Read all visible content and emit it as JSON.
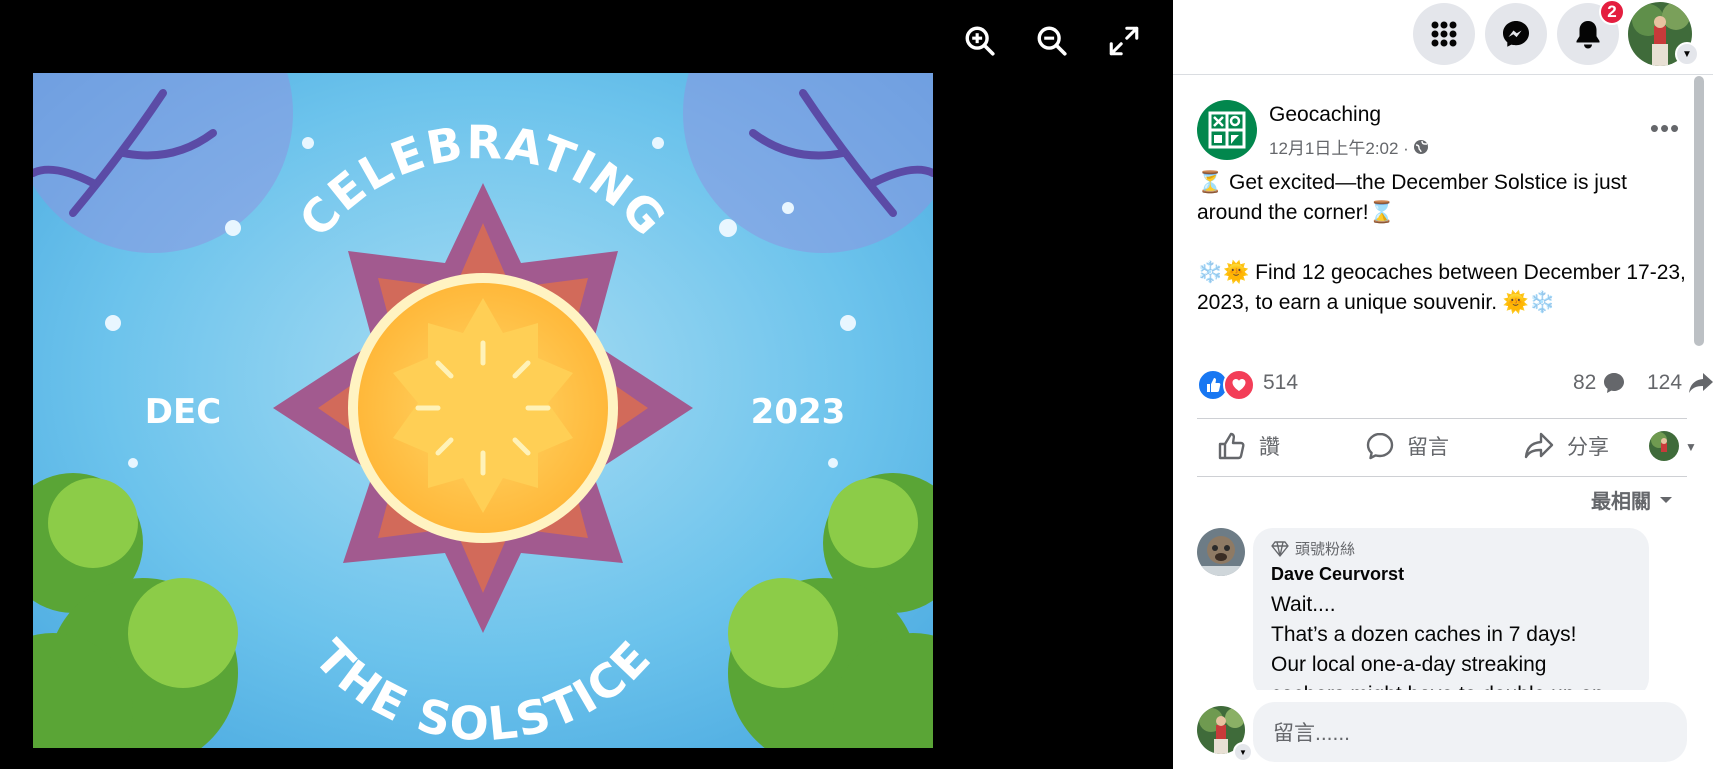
{
  "viewer": {
    "tools": [
      "zoom-in",
      "zoom-out",
      "fullscreen"
    ],
    "image": {
      "top_text": "CELEBRATING",
      "bottom_text": "THE SOLSTICE",
      "left_text": "DEC",
      "right_text": "2023"
    }
  },
  "topbar": {
    "menu_icon": "grid-menu-icon",
    "messenger_icon": "messenger-icon",
    "notifications_icon": "bell-icon",
    "notification_count": "2"
  },
  "post": {
    "page_name": "Geocaching",
    "time": "12月1日上午2:02 ·",
    "paragraph1": "⏳ Get excited—the December Solstice is just around the corner!⌛",
    "paragraph2": "❄️🌞 Find 12 geocaches between December 17-23, 2023, to earn a unique souvenir. 🌞❄️",
    "reactions_count": "514",
    "comments_count": "82",
    "shares_count": "124",
    "like_label": "讚",
    "comment_label": "留言",
    "share_label": "分享",
    "sort_label": "最相關"
  },
  "comment": {
    "badge": "頭號粉絲",
    "author": "Dave Ceurvorst",
    "lines": [
      "Wait....",
      "That’s a dozen caches in 7 days!",
      "Our local one-a-day streaking",
      "cachers might have to double up on"
    ]
  },
  "compose": {
    "placeholder": "留言......"
  },
  "colors": {
    "brand_green": "#02874d",
    "like_blue": "#1877f2",
    "love_red": "#f33e58",
    "badge_red": "#e41e3f"
  }
}
